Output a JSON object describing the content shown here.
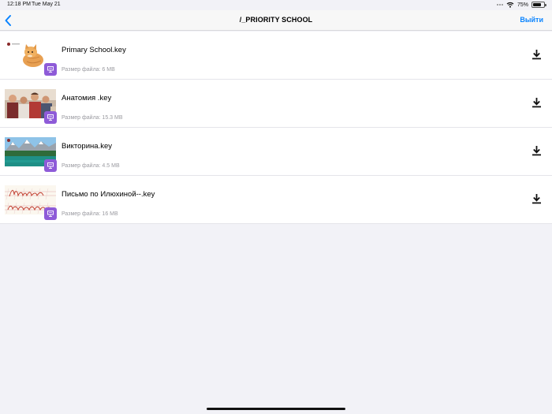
{
  "status_bar": {
    "time": "12:18 PM",
    "date": "Tue May 21",
    "battery_text": "75%",
    "battery_level": 0.75
  },
  "nav": {
    "title": "/_PRIORITY SCHOOL",
    "exit_label": "Выйти",
    "accent_color": "#0a84ff"
  },
  "files": [
    {
      "name": "Primary School.key",
      "size": "Размер файла: 6 MB",
      "thumbnail": "kitten-photo",
      "badge_icon": "keynote-icon"
    },
    {
      "name": "Анатомия .key",
      "size": "Размер файла: 15.3 MB",
      "thumbnail": "family-photo",
      "badge_icon": "keynote-icon"
    },
    {
      "name": "Викторина.key",
      "size": "Размер файла: 4.5 MB",
      "thumbnail": "mountain-lake-photo",
      "badge_icon": "keynote-icon"
    },
    {
      "name": "Письмо по Илюхиной--.key",
      "size": "Размер файла: 16 MB",
      "thumbnail": "handwriting-image",
      "badge_icon": "keynote-icon"
    }
  ],
  "colors": {
    "badge": "#8e5bd8",
    "secondary_text": "#9a9aa0",
    "background": "#f2f2f7"
  }
}
